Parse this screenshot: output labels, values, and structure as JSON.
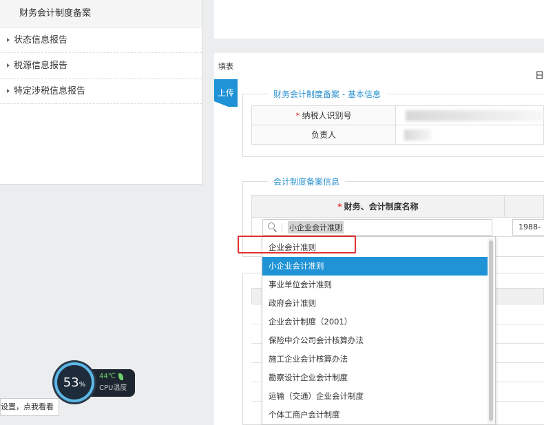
{
  "sidebar": {
    "header": "财务会计制度备案",
    "items": [
      {
        "label": "状态信息报告"
      },
      {
        "label": "税源信息报告"
      },
      {
        "label": "特定涉税信息报告"
      }
    ]
  },
  "main": {
    "tianbiao": "填表",
    "r_char": "日",
    "upload_tab": "上传",
    "basic_section": {
      "legend": "财务会计制度备案 - 基本信息",
      "taxpayer_id_label": "纳税人识别号",
      "responsible_label": "负责人",
      "required_mark": "*"
    },
    "filing_section": {
      "legend": "会计制度备案信息",
      "name_header": "财务、会计制度名称",
      "search_value": "小企业会计准则",
      "date_value": "1988-"
    }
  },
  "dropdown": {
    "options": [
      "企业会计准则",
      "小企业会计准则",
      "事业单位会计准则",
      "政府会计准则",
      "企业会计制度（2001）",
      "保险中介公司会计核算办法",
      "施工企业会计核算办法",
      "勘察设计企业会计制度",
      "运输（交通）企业会计制度",
      "个体工商户会计制度"
    ],
    "selected_index": 1
  },
  "widget": {
    "cpu_percent": "53",
    "percent_sign": "%",
    "temperature": "44℃",
    "label": "CPU温度",
    "tooltip": "设置，点我看看"
  },
  "colors": {
    "accent": "#1f93d6",
    "legend_text": "#2b91cf",
    "highlight_box": "#e03131",
    "required": "#e53a3a"
  }
}
